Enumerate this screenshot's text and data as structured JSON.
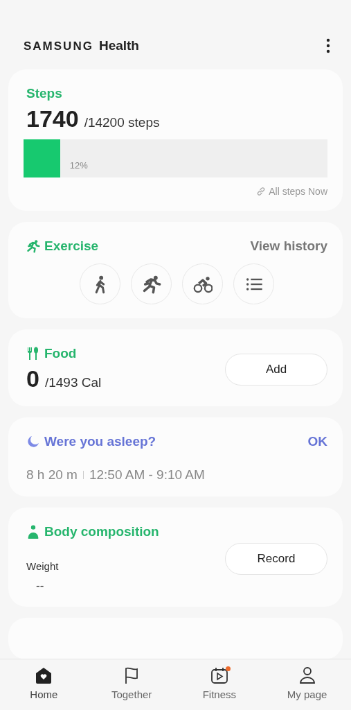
{
  "app_title": {
    "brand": "SAMSUNG",
    "name": "Health"
  },
  "steps": {
    "title": "Steps",
    "count": "1740",
    "goal": "/14200 steps",
    "level": 0.12,
    "percent": "12%",
    "source": "All steps Now"
  },
  "exercise": {
    "title": "Exercise",
    "link": "View history",
    "shortcuts": [
      {
        "kind": "walk"
      },
      {
        "kind": "run"
      },
      {
        "kind": "cycle"
      },
      {
        "kind": "list"
      }
    ]
  },
  "food": {
    "title": "Food",
    "count": "0",
    "goal": "/1493 Cal",
    "button": "Add"
  },
  "sleep": {
    "title": "Were you asleep?",
    "action": "OK",
    "duration": "8 h 20 m",
    "range": "12:50 AM - 9:10 AM"
  },
  "body": {
    "title": "Body composition",
    "label": "Weight",
    "value": "--",
    "button": "Record"
  },
  "nav": [
    {
      "kind": "home",
      "label": "Home",
      "selected": true,
      "badge": false
    },
    {
      "kind": "flag",
      "label": "Together",
      "selected": false,
      "badge": false
    },
    {
      "kind": "fitness",
      "label": "Fitness",
      "selected": false,
      "badge": true
    },
    {
      "kind": "person",
      "label": "My page",
      "selected": false,
      "badge": false
    }
  ]
}
